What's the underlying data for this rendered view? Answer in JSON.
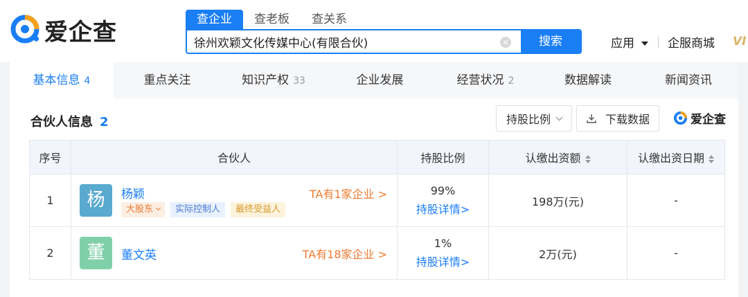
{
  "header": {
    "logo_text": "爱企查",
    "search_tabs": [
      "查企业",
      "查老板",
      "查关系"
    ],
    "search_value": "徐州欢颖文化传媒中心(有限合伙)",
    "clear_label": "×",
    "search_button": "搜索",
    "nav": {
      "apps": "应用",
      "mall": "企服商城",
      "vip": "VI"
    }
  },
  "tabs": [
    {
      "label": "基本信息",
      "count": "4"
    },
    {
      "label": "重点关注",
      "count": ""
    },
    {
      "label": "知识产权",
      "count": "33"
    },
    {
      "label": "企业发展",
      "count": ""
    },
    {
      "label": "经营状况",
      "count": "2"
    },
    {
      "label": "数据解读",
      "count": ""
    },
    {
      "label": "新闻资讯",
      "count": ""
    }
  ],
  "section": {
    "title": "合伙人信息",
    "count": "2",
    "ratio_button": "持股比例",
    "download_button": "下载数据",
    "brand": "爱企查"
  },
  "table": {
    "headers": {
      "index": "序号",
      "partner": "合伙人",
      "ratio": "持股比例",
      "amount": "认缴出资额",
      "date": "认缴出资日期"
    },
    "rows": [
      {
        "index": "1",
        "avatar_char": "杨",
        "name": "杨颖",
        "tags": [
          "大股东",
          "实际控制人",
          "最终受益人"
        ],
        "ta_link": "TA有1家企业 >",
        "ratio": "99%",
        "ratio_link": "持股详情>",
        "amount": "198万(元)",
        "date": "-"
      },
      {
        "index": "2",
        "avatar_char": "董",
        "name": "董文英",
        "tags": [],
        "ta_link": "TA有18家企业 >",
        "ratio": "1%",
        "ratio_link": "持股详情>",
        "amount": "2万(元)",
        "date": "-"
      }
    ]
  },
  "colors": {
    "accent": "#1a7ef5",
    "orange_link": "#f07a31",
    "avatar_1": "#5aa9cf",
    "avatar_2": "#7fd0a8"
  }
}
